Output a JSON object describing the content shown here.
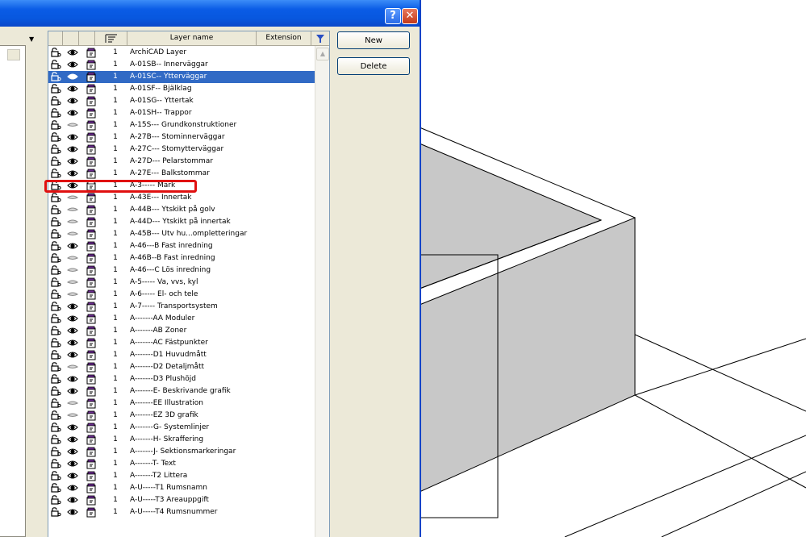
{
  "dialog": {
    "help_label": "?",
    "close_label": "✕"
  },
  "columns": {
    "layer_name": "Layer name",
    "extension": "Extension"
  },
  "buttons": {
    "new": "New",
    "delete": "Delete"
  },
  "icons": {
    "lock": "lock-icon",
    "visibility": "eye-icon",
    "edit": "edit-status-icon",
    "filter": "filter-icon"
  },
  "selected_row": "A-01SC-- Ytterväggar",
  "highlighted_row": "A-3----- Mark",
  "layers": [
    {
      "num": "1",
      "name": "ArchiCAD Layer",
      "eye": true,
      "lock": false
    },
    {
      "num": "1",
      "name": "A-01SB-- Innerväggar",
      "eye": true,
      "lock": false
    },
    {
      "num": "1",
      "name": "A-01SC-- Ytterväggar",
      "eye": true,
      "lock": false
    },
    {
      "num": "1",
      "name": "A-01SF-- Bjälklag",
      "eye": true,
      "lock": false
    },
    {
      "num": "1",
      "name": "A-01SG-- Yttertak",
      "eye": true,
      "lock": false
    },
    {
      "num": "1",
      "name": "A-01SH-- Trappor",
      "eye": true,
      "lock": false
    },
    {
      "num": "1",
      "name": "A-15S--- Grundkonstruktioner",
      "eye": false,
      "lock": false
    },
    {
      "num": "1",
      "name": "A-27B--- Stominnerväggar",
      "eye": true,
      "lock": false
    },
    {
      "num": "1",
      "name": "A-27C--- Stomytterväggar",
      "eye": true,
      "lock": false
    },
    {
      "num": "1",
      "name": "A-27D--- Pelarstommar",
      "eye": true,
      "lock": false
    },
    {
      "num": "1",
      "name": "A-27E--- Balkstommar",
      "eye": true,
      "lock": false
    },
    {
      "num": "1",
      "name": "A-3----- Mark",
      "eye": true,
      "lock": true
    },
    {
      "num": "1",
      "name": "A-43E--- Innertak",
      "eye": false,
      "lock": false
    },
    {
      "num": "1",
      "name": "A-44B--- Ytskikt på golv",
      "eye": false,
      "lock": false
    },
    {
      "num": "1",
      "name": "A-44D--- Ytskikt på innertak",
      "eye": false,
      "lock": false
    },
    {
      "num": "1",
      "name": "A-45B--- Utv hu...ompletteringar",
      "eye": false,
      "lock": false
    },
    {
      "num": "1",
      "name": "A-46---B Fast inredning",
      "eye": true,
      "lock": false
    },
    {
      "num": "1",
      "name": "A-46B--B Fast inredning",
      "eye": false,
      "lock": false
    },
    {
      "num": "1",
      "name": "A-46---C Lös inredning",
      "eye": false,
      "lock": false
    },
    {
      "num": "1",
      "name": "A-5----- Va, vvs, kyl",
      "eye": false,
      "lock": false
    },
    {
      "num": "1",
      "name": "A-6----- El- och tele",
      "eye": false,
      "lock": false
    },
    {
      "num": "1",
      "name": "A-7----- Transportsystem",
      "eye": true,
      "lock": false
    },
    {
      "num": "1",
      "name": "A-------AA Moduler",
      "eye": true,
      "lock": false
    },
    {
      "num": "1",
      "name": "A-------AB Zoner",
      "eye": true,
      "lock": false
    },
    {
      "num": "1",
      "name": "A-------AC Fästpunkter",
      "eye": true,
      "lock": false
    },
    {
      "num": "1",
      "name": "A-------D1 Huvudmått",
      "eye": true,
      "lock": false
    },
    {
      "num": "1",
      "name": "A-------D2 Detaljmått",
      "eye": false,
      "lock": false
    },
    {
      "num": "1",
      "name": "A-------D3 Plushöjd",
      "eye": true,
      "lock": false
    },
    {
      "num": "1",
      "name": "A-------E- Beskrivande grafik",
      "eye": true,
      "lock": false
    },
    {
      "num": "1",
      "name": "A-------EE Illustration",
      "eye": false,
      "lock": false
    },
    {
      "num": "1",
      "name": "A-------EZ 3D grafik",
      "eye": false,
      "lock": false
    },
    {
      "num": "1",
      "name": "A-------G- Systemlinjer",
      "eye": true,
      "lock": false
    },
    {
      "num": "1",
      "name": "A-------H- Skraffering",
      "eye": true,
      "lock": false
    },
    {
      "num": "1",
      "name": "A-------J- Sektionsmarkeringar",
      "eye": true,
      "lock": false
    },
    {
      "num": "1",
      "name": "A-------T- Text",
      "eye": true,
      "lock": false
    },
    {
      "num": "1",
      "name": "A-------T2 Littera",
      "eye": true,
      "lock": false
    },
    {
      "num": "1",
      "name": "A-U-----T1 Rumsnamn",
      "eye": true,
      "lock": false
    },
    {
      "num": "1",
      "name": "A-U-----T3 Areauppgift",
      "eye": true,
      "lock": false
    },
    {
      "num": "1",
      "name": "A-U-----T4 Rumsnummer",
      "eye": true,
      "lock": false
    }
  ]
}
